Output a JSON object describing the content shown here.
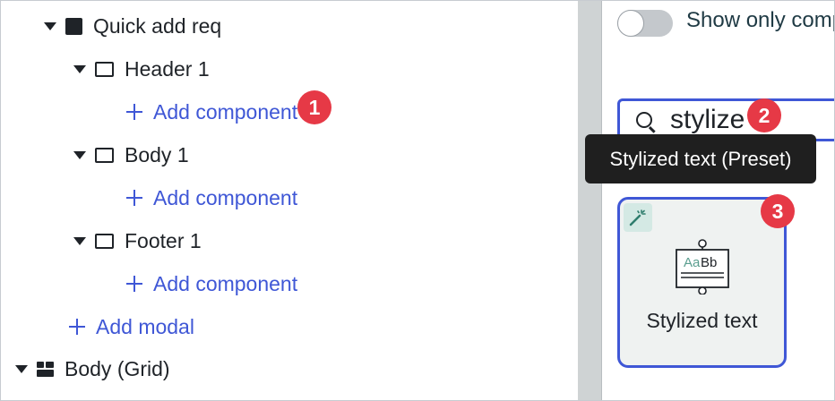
{
  "tree": {
    "quick_add": "Quick add req",
    "header": "Header 1",
    "body": "Body 1",
    "footer": "Footer 1",
    "add_component": "Add component",
    "add_modal": "Add modal",
    "body_grid": "Body (Grid)"
  },
  "right_panel": {
    "toggle_label": "Show only compatible",
    "search_value": "stylize",
    "card_title": "Stylized text",
    "card_preview_text": "AaBb",
    "tooltip": "Stylized text (Preset)"
  },
  "badges": {
    "one": "1",
    "two": "2",
    "three": "3"
  },
  "icons": [
    "caret-down-icon",
    "filled-square-icon",
    "outline-square-icon",
    "plus-icon",
    "grid-layout-icon",
    "search-icon",
    "magic-wand-icon",
    "stylized-text-icon"
  ],
  "colors": {
    "accent": "#3f57d6",
    "badge": "#e63946",
    "tooltip_bg": "#1f1f1f",
    "divider": "#cfd3d4"
  }
}
